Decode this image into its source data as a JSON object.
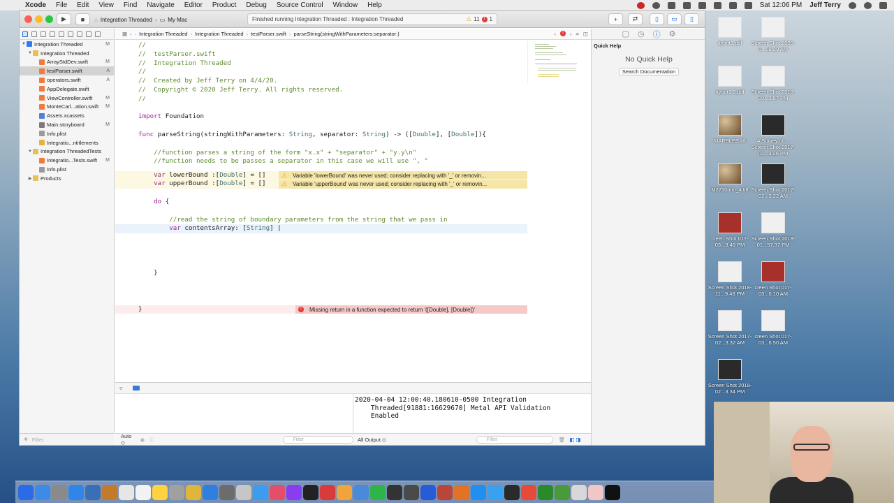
{
  "menubar": {
    "app": "Xcode",
    "menus": [
      "File",
      "Edit",
      "View",
      "Find",
      "Navigate",
      "Editor",
      "Product",
      "Debug",
      "Source Control",
      "Window",
      "Help"
    ],
    "clock": "Sat 12:06 PM",
    "user": "Jeff Terry"
  },
  "toolbar": {
    "scheme": "Integration Threaded",
    "destination": "My Mac",
    "activity": "Finished running Integration Threaded : Integration Threaded",
    "warning_count": "11",
    "error_count": "1"
  },
  "navigator": {
    "items": [
      {
        "label": "Integration Threaded",
        "badge": "M",
        "depth": 0,
        "disclosure": "▼",
        "color": "#3478f6"
      },
      {
        "label": "Integration Threaded",
        "badge": "",
        "depth": 1,
        "disclosure": "▼",
        "color": "#e8c153"
      },
      {
        "label": "ArrayStdDev.swift",
        "badge": "M",
        "depth": 2,
        "disclosure": "",
        "color": "#f07b3f"
      },
      {
        "label": "testParser.swift",
        "badge": "A",
        "depth": 2,
        "disclosure": "",
        "color": "#f07b3f",
        "selected": true
      },
      {
        "label": "operators.swift",
        "badge": "A",
        "depth": 2,
        "disclosure": "",
        "color": "#f07b3f"
      },
      {
        "label": "AppDelegate.swift",
        "badge": "",
        "depth": 2,
        "disclosure": "",
        "color": "#f07b3f"
      },
      {
        "label": "ViewController.swift",
        "badge": "M",
        "depth": 2,
        "disclosure": "",
        "color": "#f07b3f"
      },
      {
        "label": "MonteCarl...ation.swift",
        "badge": "M",
        "depth": 2,
        "disclosure": "",
        "color": "#f07b3f"
      },
      {
        "label": "Assets.xcassets",
        "badge": "",
        "depth": 2,
        "disclosure": "",
        "color": "#4f7fd6"
      },
      {
        "label": "Main.storyboard",
        "badge": "M",
        "depth": 2,
        "disclosure": "",
        "color": "#7a7a7a"
      },
      {
        "label": "Info.plist",
        "badge": "",
        "depth": 2,
        "disclosure": "",
        "color": "#9a9a9a"
      },
      {
        "label": "Integratio...ntitlements",
        "badge": "",
        "depth": 2,
        "disclosure": "",
        "color": "#e3b341"
      },
      {
        "label": "Integration ThreadedTests",
        "badge": "",
        "depth": 1,
        "disclosure": "▼",
        "color": "#e8c153"
      },
      {
        "label": "Integratio...Tests.swift",
        "badge": "M",
        "depth": 2,
        "disclosure": "",
        "color": "#f07b3f"
      },
      {
        "label": "Info.plist",
        "badge": "",
        "depth": 2,
        "disclosure": "",
        "color": "#9a9a9a"
      },
      {
        "label": "Products",
        "badge": "",
        "depth": 1,
        "disclosure": "▶",
        "color": "#e8c153"
      }
    ],
    "filter_placeholder": "Filter"
  },
  "jumpbar": {
    "crumbs": [
      "Integration Threaded",
      "Integration Threaded",
      "testParser.swift",
      "parseString(stringWithParameters:separator:)"
    ]
  },
  "code": {
    "l1": "//",
    "l2": "//  testParser.swift",
    "l3": "//  Integration Threaded",
    "l4": "//",
    "l5": "//  Created by Jeff Terry on 4/4/20.",
    "l6": "//  Copyright © 2020 Jeff Terry. All rights reserved.",
    "l7": "//",
    "l8_kw": "import",
    "l8_rest": " Foundation",
    "l9_kw": "func",
    "l9_a": " parseString(stringWithParameters: ",
    "l9_t1": "String",
    "l9_b": ", separator: ",
    "l9_t2": "String",
    "l9_c": ") -> ([",
    "l9_t3": "Double",
    "l9_d": "], [",
    "l9_t4": "Double",
    "l9_e": "]){",
    "l10": "    //function parses a string of the form \"x.x\" + \"separator\" + \"y.y\\n\"",
    "l11": "    //function needs to be passes a separator in this case we will use \", \"",
    "l12_kw": "    var",
    "l12_a": " lowerBound :[",
    "l12_t": "Double",
    "l12_b": "] = []",
    "l13_kw": "    var",
    "l13_a": " upperBound :[",
    "l13_t": "Double",
    "l13_b": "] = []",
    "l14_kw": "    do",
    "l14_rest": " {",
    "l15": "        //read the string of boundary parameters from the string that we pass in",
    "l16_kw": "        var",
    "l16_a": " contentsArray: [",
    "l16_t": "String",
    "l16_b": "] |",
    "l17": "    }",
    "l18": "}"
  },
  "issues": {
    "warn1": "Variable 'lowerBound' was never used; consider replacing with '_' or removin...",
    "warn2": "Variable 'upperBound' was never used; consider replacing with '_' or removin...",
    "err1": "Missing return in a function expected to return '([Double], [Double])'"
  },
  "debug": {
    "console_text": "2020-04-04 12:00:40.180610-0500 Integration\n    Threaded[91881:16629670] Metal API Validation\n    Enabled",
    "auto_label": "Auto ◇",
    "all_output_label": "All Output ◇",
    "filter_placeholder": "Filter"
  },
  "inspector": {
    "title": "Quick Help",
    "empty_text": "No Quick Help",
    "search_button": "Search Documentation"
  },
  "desktop": {
    "icons": [
      {
        "label": "ayout1.pdf",
        "style": "white"
      },
      {
        "label": "Screen Shot 2020-0...08.29 AM",
        "style": "white"
      },
      {
        "label": "ayout1 2.pdf",
        "style": "white"
      },
      {
        "label": "Screen Shot 2018-09...2.57 PM",
        "style": "white"
      },
      {
        "label": "MARBLES.tiff",
        "style": "marble"
      },
      {
        "label": "A Survey of ... Screen Shot 2017-02...3.26 PM",
        "style": "dark"
      },
      {
        "label": "M2710min_4.tiff",
        "style": "marble"
      },
      {
        "label": "Screen Shot 2017-02...3.22 AM",
        "style": "dark"
      },
      {
        "label": "creen Shot 017-03...9.46 PM",
        "style": "red"
      },
      {
        "label": "Screen Shot 2018-01...57.37 PM",
        "style": "white"
      },
      {
        "label": "Screen Shot 2018-11...9.46 PM",
        "style": "white"
      },
      {
        "label": "creen Shot 017-03...0.10 AM",
        "style": "red"
      },
      {
        "label": "Screen Shot 2017-02...3.32 AM",
        "style": "white"
      },
      {
        "label": "creen Shot 017-03...6.50 AM",
        "style": "white"
      },
      {
        "label": "Screen Shot 2018-02...3.34 PM",
        "style": "dark"
      }
    ]
  },
  "dock": {
    "apps": [
      "#2a6be6",
      "#3d8be8",
      "#8a8a8a",
      "#2f86e8",
      "#3a6fb6",
      "#c47a2b",
      "#e6e6e6",
      "#f2f2f2",
      "#ffd23f",
      "#a0a0a0",
      "#e0b53b",
      "#2f7fe0",
      "#6c6c6c",
      "#c6c6c6",
      "#3c9cf0",
      "#e34f6a",
      "#8a3df0",
      "#222222",
      "#d83b3b",
      "#f1a43c",
      "#4a8ad8",
      "#2fb44a",
      "#333333",
      "#4a4a4a",
      "#2a5bd6",
      "#b8463a",
      "#e37324",
      "#1f8ff0",
      "#3aa0f0",
      "#2a2a2a",
      "#e84a3a",
      "#2a8a2a",
      "#4a9a3a",
      "#d8d8d8",
      "#f2c6c6",
      "#111111"
    ]
  }
}
